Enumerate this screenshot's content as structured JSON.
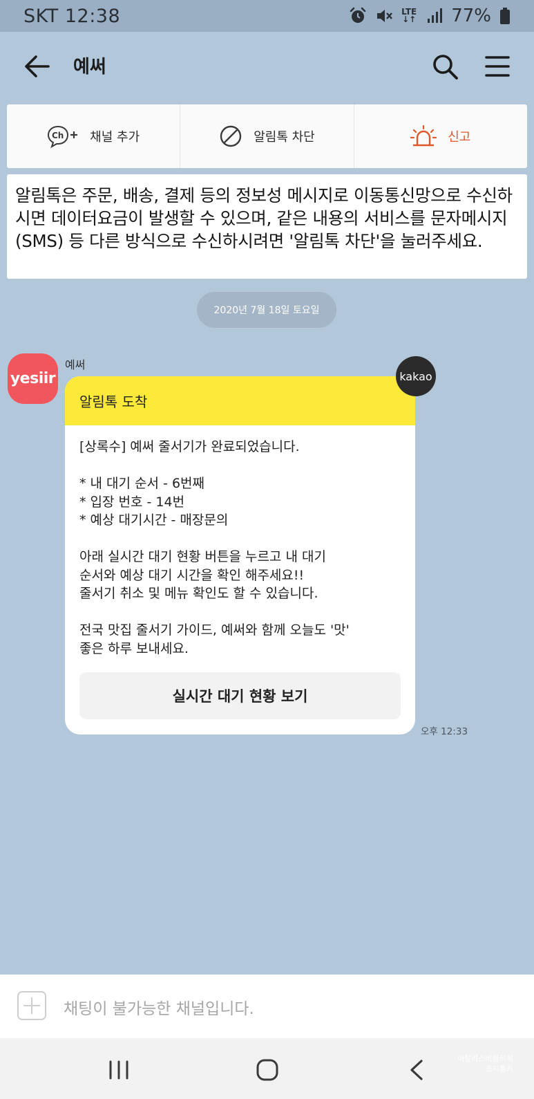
{
  "status_bar": {
    "carrier": "SKT",
    "time": "12:38",
    "network": "LTE",
    "battery": "77%"
  },
  "header": {
    "title": "예써"
  },
  "actions": {
    "add_channel": "채널 추가",
    "block": "알림톡 차단",
    "report": "신고",
    "report_color": "#e0582a"
  },
  "notice": {
    "text": "알림톡은 주문, 배송, 결제 등의 정보성 메시지로 이동통신망으로 수신하시면 데이터요금이 발생할 수 있으며, 같은 내용의 서비스를 문자메시지(SMS) 등 다른 방식으로 수신하시려면 '알림톡 차단'을 눌러주세요."
  },
  "date_divider": "2020년 7월 18일 토요일",
  "message": {
    "sender": "예써",
    "avatar_text": "yesiir",
    "avatar_color": "#f0565c",
    "badge": "kakao",
    "header": "알림톡 도착",
    "header_color": "#fde93a",
    "lines": {
      "l1": "[상록수] 예써 줄서기가 완료되었습니다.",
      "l2": "* 내 대기 순서 - 6번째",
      "l3": "* 입장 번호 - 14번",
      "l4": "* 예상 대기시간 - 매장문의",
      "l5": "아래 실시간 대기 현황 버튼을 누르고 내 대기",
      "l6": "순서와 예상 대기 시간을 확인 해주세요!!",
      "l7": "줄서기 취소 및 메뉴 확인도 할 수 있습니다.",
      "l8": "전국 맛집 줄서기 가이드, 예써와 함께 오늘도 '맛'",
      "l9": "좋은 하루 보내세요."
    },
    "button": "실시간 대기 현황 보기",
    "time": "오후 12:33"
  },
  "input": {
    "placeholder": "채팅이 불가능한 채널입니다."
  },
  "watermark": {
    "line1": "이탈리스버블리체",
    "line2": "조지통키"
  }
}
